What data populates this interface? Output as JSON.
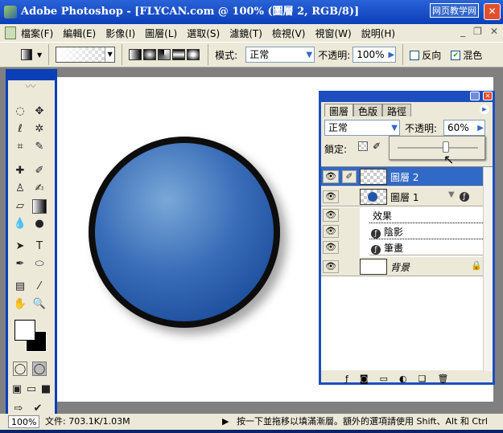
{
  "window": {
    "title": "Adobe Photoshop - [FLYCAN.com @ 100% (圖層 2, RGB/8)]",
    "watermark": "网页教学网",
    "close": "✕"
  },
  "menu": [
    "檔案(F)",
    "編輯(E)",
    "影像(I)",
    "圖層(L)",
    "選取(S)",
    "濾鏡(T)",
    "檢視(V)",
    "視窗(W)",
    "說明(H)"
  ],
  "doc_controls": [
    "_",
    "❐",
    "✕"
  ],
  "options": {
    "mode_label": "模式:",
    "mode_value": "正常",
    "opacity_label": "不透明:",
    "opacity_value": "100%",
    "reverse_label": "反向",
    "dither_label": "混色",
    "dither_checked": true,
    "reverse_checked": false
  },
  "layers_panel": {
    "tabs": [
      "圖層",
      "色版",
      "路徑"
    ],
    "blend_mode": "正常",
    "opacity_label": "不透明:",
    "opacity_value": "60%",
    "opacity_slider": 0.6,
    "lock_label": "鎖定:",
    "layers": [
      {
        "name": "圖層 2",
        "selected": true
      },
      {
        "name": "圖層 1"
      }
    ],
    "effects_label": "效果",
    "effects": [
      "陰影",
      "筆畫"
    ],
    "background": "背景"
  },
  "status": {
    "zoom": "100%",
    "doc": "文件: 703.1K/1.03M",
    "hint": "按一下並拖移以填滿漸層。額外的選項請使用 Shift、Alt 和 Ctrl"
  }
}
